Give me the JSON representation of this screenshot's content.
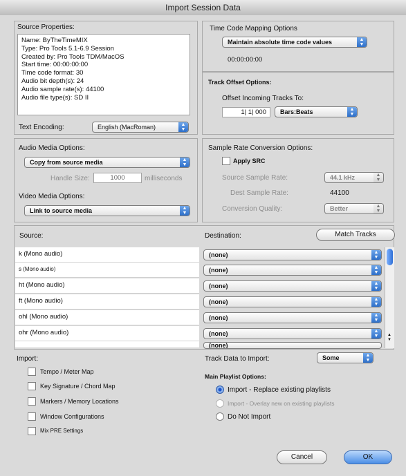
{
  "title": "Import Session Data",
  "source_properties": {
    "heading": "Source Properties:",
    "lines": [
      "Name: ByTheTimeMIX",
      "Type: Pro Tools 5.1-6.9 Session",
      "Created by: Pro Tools TDM/MacOS",
      "Start time: 00:00:00:00",
      "Time code format: 30",
      "Audio bit depth(s): 24",
      "Audio sample rate(s): 44100",
      "Audio file type(s): SD II"
    ],
    "text_encoding_label": "Text Encoding:",
    "text_encoding_value": "English (MacRoman)"
  },
  "timecode": {
    "heading": "Time Code Mapping Options",
    "mapping_value": "Maintain absolute time code values",
    "timecode_value": "00:00:00:00"
  },
  "track_offset": {
    "heading": "Track Offset Options:",
    "offset_label": "Offset Incoming Tracks To:",
    "offset_value": "1| 1| 000",
    "units_value": "Bars:Beats"
  },
  "audio_media": {
    "heading": "Audio Media Options:",
    "value": "Copy from source media",
    "handle_label": "Handle Size:",
    "handle_value": "1000",
    "handle_units": "milliseconds"
  },
  "video_media": {
    "heading": "Video Media Options:",
    "value": "Link to source media"
  },
  "src": {
    "heading": "Sample Rate Conversion Options:",
    "apply_label": "Apply SRC",
    "source_rate_label": "Source Sample Rate:",
    "source_rate_value": "44.1 kHz",
    "dest_rate_label": "Dest Sample Rate:",
    "dest_rate_value": "44100",
    "quality_label": "Conversion Quality:",
    "quality_value": "Better"
  },
  "tracks": {
    "source_label": "Source:",
    "destination_label": "Destination:",
    "match_button": "Match Tracks",
    "rows": [
      {
        "source": "k (Mono audio)",
        "destination": "(none)"
      },
      {
        "source": "s (Mono audio)",
        "destination": "(none)"
      },
      {
        "source": "ht (Mono audio)",
        "destination": "(none)"
      },
      {
        "source": "ft (Mono audio)",
        "destination": "(none)"
      },
      {
        "source": "ohl (Mono audio)",
        "destination": "(none)"
      },
      {
        "source": "ohr (Mono audio)",
        "destination": "(none)"
      },
      {
        "source": "",
        "destination": "(none)"
      }
    ]
  },
  "import": {
    "heading": "Import:",
    "options": [
      "Tempo / Meter Map",
      "Key Signature / Chord Map",
      "Markers / Memory Locations",
      "Window Configurations",
      "Mix PRE Settings"
    ]
  },
  "track_data": {
    "label": "Track Data to Import:",
    "value": "Some"
  },
  "playlist": {
    "heading": "Main Playlist Options:",
    "options": [
      "Import - Replace existing playlists",
      "Import - Overlay new on existing playlists",
      "Do Not Import"
    ]
  },
  "buttons": {
    "cancel": "Cancel",
    "ok": "OK"
  }
}
